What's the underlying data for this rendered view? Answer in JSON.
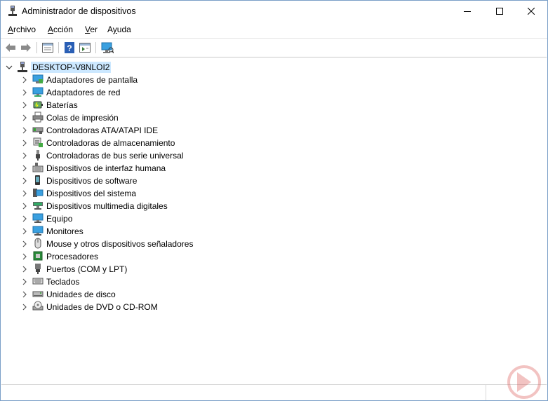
{
  "window": {
    "title": "Administrador de dispositivos"
  },
  "menu": [
    {
      "label": "Archivo",
      "accel": "A",
      "rest": "rchivo"
    },
    {
      "label": "Acción",
      "accel": "A",
      "rest": "cción"
    },
    {
      "label": "Ver",
      "accel": "V",
      "rest": "er"
    },
    {
      "label": "Ayuda",
      "accel": "y",
      "rest": "uda"
    }
  ],
  "toolbar": {
    "buttons": [
      "back-icon",
      "forward-icon",
      "properties-icon",
      "help-icon",
      "view-icon",
      "scan-hardware-icon"
    ]
  },
  "tree": {
    "root": "DESKTOP-V8NLOI2",
    "items": [
      {
        "label": "Adaptadores de pantalla",
        "icon": "display-adapter-icon"
      },
      {
        "label": "Adaptadores de red",
        "icon": "network-adapter-icon"
      },
      {
        "label": "Baterías",
        "icon": "battery-icon"
      },
      {
        "label": "Colas de impresión",
        "icon": "printer-icon"
      },
      {
        "label": "Controladoras ATA/ATAPI IDE",
        "icon": "ide-controller-icon"
      },
      {
        "label": "Controladoras de almacenamiento",
        "icon": "storage-controller-icon"
      },
      {
        "label": "Controladoras de bus serie universal",
        "icon": "usb-icon"
      },
      {
        "label": "Dispositivos de interfaz humana",
        "icon": "hid-icon"
      },
      {
        "label": "Dispositivos de software",
        "icon": "software-device-icon"
      },
      {
        "label": "Dispositivos del sistema",
        "icon": "system-device-icon"
      },
      {
        "label": "Dispositivos multimedia digitales",
        "icon": "multimedia-icon"
      },
      {
        "label": "Equipo",
        "icon": "computer-icon"
      },
      {
        "label": "Monitores",
        "icon": "monitor-icon"
      },
      {
        "label": "Mouse y otros dispositivos señaladores",
        "icon": "mouse-icon"
      },
      {
        "label": "Procesadores",
        "icon": "processor-icon"
      },
      {
        "label": "Puertos (COM y LPT)",
        "icon": "port-icon"
      },
      {
        "label": "Teclados",
        "icon": "keyboard-icon"
      },
      {
        "label": "Unidades de disco",
        "icon": "disk-drive-icon"
      },
      {
        "label": "Unidades de DVD o CD-ROM",
        "icon": "dvd-icon"
      }
    ]
  },
  "colors": {
    "selection": "#cce8ff",
    "accent": "#1e78c8",
    "watermark": "#d9534f"
  }
}
